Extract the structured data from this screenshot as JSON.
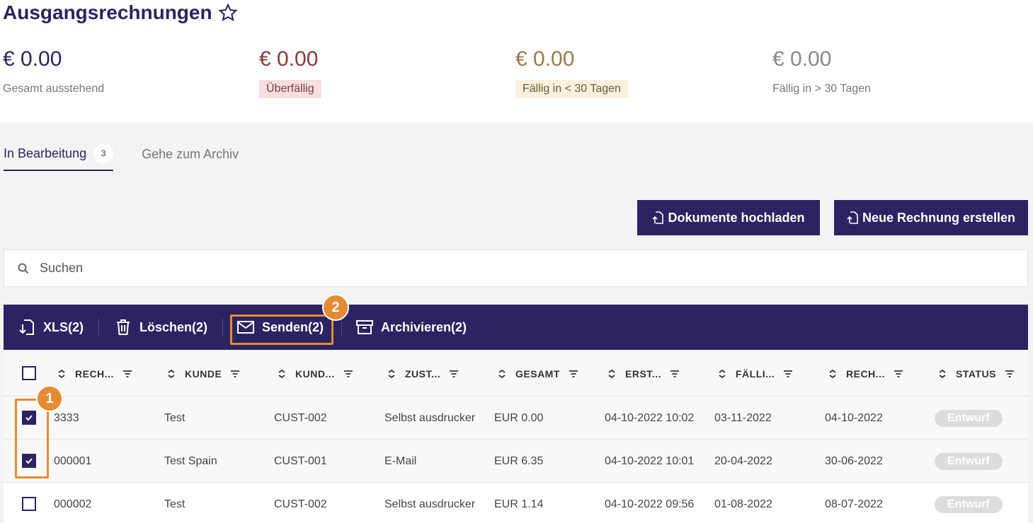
{
  "page": {
    "title": "Ausgangsrechnungen"
  },
  "kpis": [
    {
      "amount": "€ 0.00",
      "label": "Gesamt ausstehend"
    },
    {
      "amount": "€ 0.00",
      "label": "Überfällig"
    },
    {
      "amount": "€ 0.00",
      "label": "Fällig in < 30 Tagen"
    },
    {
      "amount": "€ 0.00",
      "label": "Fällig in > 30 Tagen"
    }
  ],
  "tabs": [
    {
      "label": "In Bearbeitung",
      "count": "3"
    },
    {
      "label": "Gehe zum Archiv"
    }
  ],
  "buttons": {
    "upload": "Dokumente hochladen",
    "create": "Neue Rechnung erstellen"
  },
  "search": {
    "placeholder": "Suchen"
  },
  "bulk": {
    "xls": "XLS(2)",
    "delete": "Löschen(2)",
    "send": "Senden(2)",
    "archive": "Archivieren(2)"
  },
  "markers": {
    "one": "1",
    "two": "2"
  },
  "table": {
    "headers": [
      "RECH...",
      "KUNDE",
      "KUND...",
      "ZUST...",
      "GESAMT",
      "ERST...",
      "FÄLLI...",
      "RECH...",
      "STATUS"
    ],
    "rows": [
      {
        "checked": true,
        "c": [
          "3333",
          "Test",
          "CUST-002",
          "Selbst ausdrucker",
          "EUR 0.00",
          "04-10-2022 10:02",
          "03-11-2022",
          "04-10-2022"
        ],
        "status": "Entwurf"
      },
      {
        "checked": true,
        "c": [
          "000001",
          "Test Spain",
          "CUST-001",
          "E-Mail",
          "EUR 6.35",
          "04-10-2022 10:01",
          "20-04-2022",
          "30-06-2022"
        ],
        "status": "Entwurf"
      },
      {
        "checked": false,
        "c": [
          "000002",
          "Test",
          "CUST-002",
          "Selbst ausdrucker",
          "EUR 1.14",
          "04-10-2022 09:56",
          "01-08-2022",
          "08-07-2022"
        ],
        "status": "Entwurf"
      }
    ]
  }
}
